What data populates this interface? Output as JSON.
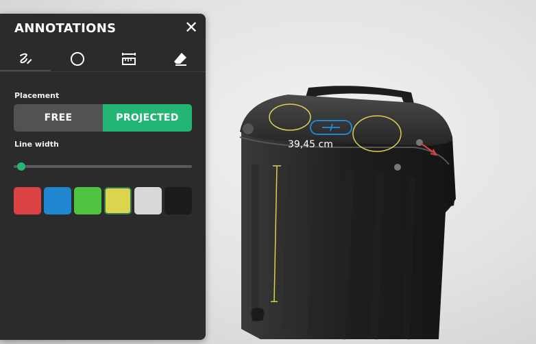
{
  "panel": {
    "title": "ANNOTATIONS",
    "close_glyph": "✕",
    "tools": [
      {
        "name": "freehand",
        "icon": "freehand-icon",
        "active": true
      },
      {
        "name": "circle",
        "icon": "circle-icon",
        "active": false
      },
      {
        "name": "ruler",
        "icon": "ruler-icon",
        "active": false
      },
      {
        "name": "eraser",
        "icon": "eraser-icon",
        "active": false
      }
    ],
    "placement_label": "Placement",
    "placement_options": [
      "FREE",
      "PROJECTED"
    ],
    "placement_selected": "PROJECTED",
    "line_width_label": "Line width",
    "line_width_value": 0.02,
    "swatches": [
      {
        "name": "red",
        "color": "#d94343"
      },
      {
        "name": "blue",
        "color": "#1f86d0"
      },
      {
        "name": "green",
        "color": "#4ec441"
      },
      {
        "name": "yellow",
        "color": "#dcd34e"
      },
      {
        "name": "white",
        "color": "#d8d8d8"
      },
      {
        "name": "black",
        "color": "#1c1c1c"
      }
    ],
    "selected_swatch": "yellow",
    "accent_color": "#22b574"
  },
  "viewport": {
    "measurement_label": "39,45 cm",
    "object": "suitcase"
  }
}
